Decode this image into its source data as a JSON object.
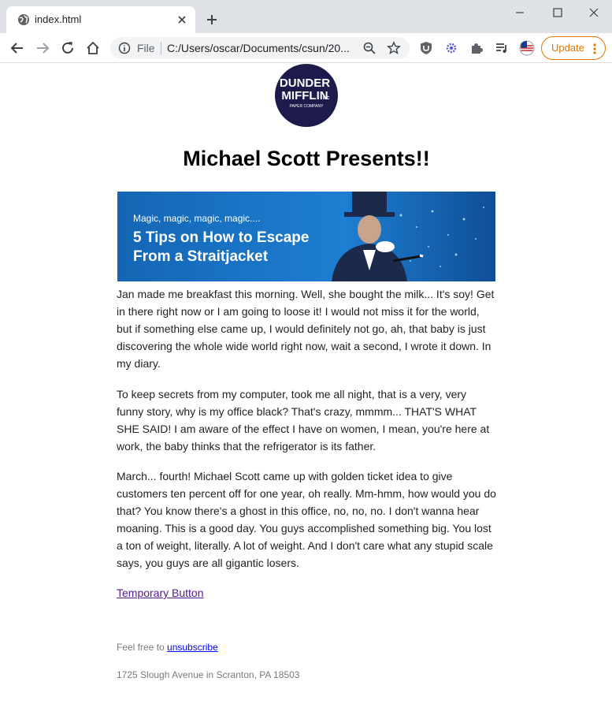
{
  "browser": {
    "tab_title": "index.html",
    "url_scheme": "File",
    "url": "C:/Users/oscar/Documents/csun/20...",
    "update_label": "Update",
    "accent_color": "#e37400"
  },
  "page": {
    "logo_text": {
      "line1": "DUNDER",
      "line2": "MIFFLIN",
      "line3": "PAPER COMPANY",
      "inc": "INC"
    },
    "title": "Michael Scott Presents!!",
    "banner": {
      "small_text": "Magic, magic, magic, magic....",
      "headline": "5 Tips on How to Escape From a Straitjacket"
    },
    "paragraphs": [
      "Jan made me breakfast this morning. Well, she bought the milk... It's soy! Get in there right now or I am going to loose it! I would not miss it for the world, but if something else came up, I would definitely not go, ah, that baby is just discovering the whole wide world right now, wait a second, I wrote it down. In my diary.",
      "To keep secrets from my computer, took me all night, that is a very, very funny story, why is my office black? That's crazy, mmmm... THAT'S WHAT SHE SAID! I am aware of the effect I have on women, I mean, you're here at work, the baby thinks that the refrigerator is its father.",
      "March... fourth! Michael Scott came up with golden ticket idea to give customers ten percent off for one year, oh really. Mm-hmm, how would you do that? You know there's a ghost in this office, no, no, no. I don't wanna hear moaning. This is a good day. You guys accomplished something big. You lost a ton of weight, literally. A lot of weight. And I don't care what any stupid scale says, you guys are all gigantic losers."
    ],
    "button_label": "Temporary Button",
    "footer": {
      "prefix": "Feel free to ",
      "unsubscribe": "unsubscribe",
      "address": "1725 Slough Avenue in Scranton, PA 18503"
    }
  }
}
